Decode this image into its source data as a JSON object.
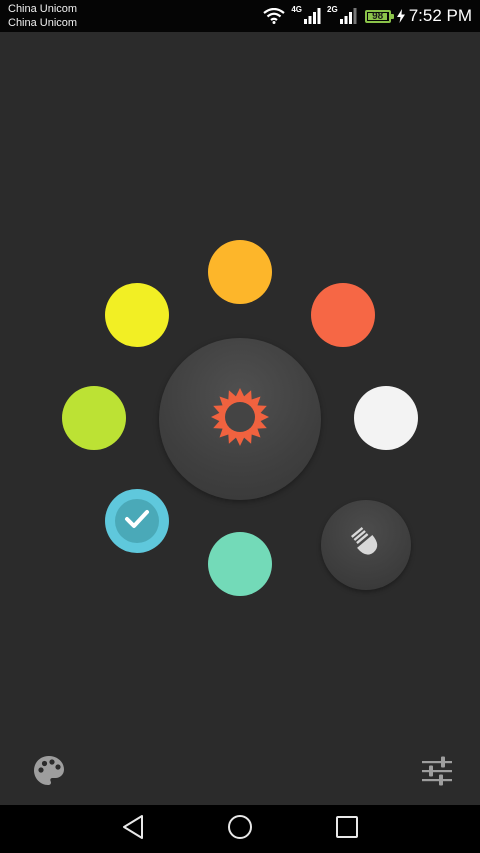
{
  "status_bar": {
    "carrier_1": "China Unicom",
    "carrier_2": "China Unicom",
    "network_1": "4G",
    "network_2": "2G",
    "battery_level": 98,
    "battery_text": "98",
    "time": "7:52 PM"
  },
  "colors": {
    "background": "#2b2b2b",
    "dots": [
      {
        "name": "orange-amber",
        "hex": "#fdb62a"
      },
      {
        "name": "coral-red",
        "hex": "#f66745"
      },
      {
        "name": "white",
        "hex": "#f3f3f3"
      },
      {
        "name": "mint",
        "hex": "#73dab8"
      },
      {
        "name": "sky-blue",
        "hex": "#5fc8dc",
        "selected": true
      },
      {
        "name": "lime",
        "hex": "#bce234"
      },
      {
        "name": "yellow",
        "hex": "#f2ef24"
      }
    ],
    "sun_icon": "#f0623f"
  },
  "icons": {
    "center": "sun-icon",
    "flash": "flashlight-icon",
    "selected": "check-icon",
    "bottom_left": "palette-icon",
    "bottom_right": "sliders-icon",
    "nav": [
      "back-icon",
      "home-icon",
      "recents-icon"
    ]
  }
}
